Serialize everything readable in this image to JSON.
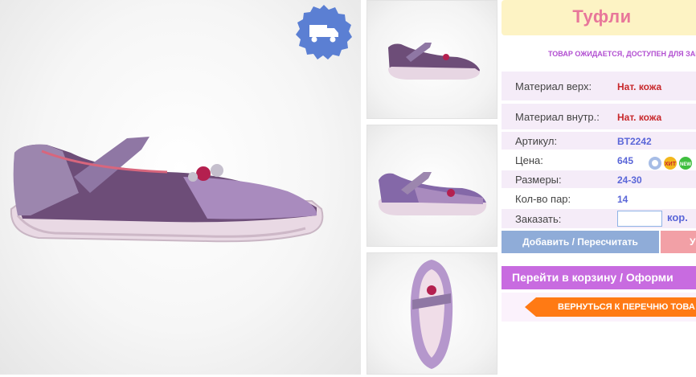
{
  "product": {
    "title": "Туфли",
    "status": "ТОВАР ОЖИДАЕТСЯ, ДОСТУПЕН ДЛЯ ЗАК"
  },
  "specs": [
    {
      "label": "Материал верх:",
      "value": "Нат. кожа"
    },
    {
      "label": "Материал внутр.:",
      "value": "Нат. кожа"
    },
    {
      "label": "Артикул:",
      "value": "BT2242"
    },
    {
      "label": "Цена:",
      "value": "645"
    },
    {
      "label": "Размеры:",
      "value": "24-30"
    },
    {
      "label": "Кол-во пар:",
      "value": "14"
    },
    {
      "label": "Заказать:",
      "value": ""
    }
  ],
  "order": {
    "unit": "кор."
  },
  "badges": {
    "hit": "ХИТ",
    "new": "NEW"
  },
  "buttons": {
    "add": "Добавить / Пересчитать",
    "delete": "У",
    "cart": "Перейти в корзину / Оформи",
    "back": "ВЕРНУТЬСЯ К ПЕРЕЧНЮ ТОВА"
  },
  "colors": {
    "accent_pink": "#e8779a",
    "purple": "#c86be0",
    "orange": "#ff7a14",
    "add_blue": "#8facd8"
  }
}
